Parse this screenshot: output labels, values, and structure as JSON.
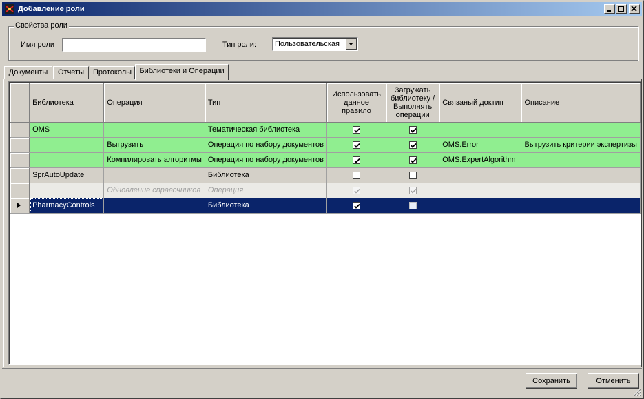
{
  "window": {
    "title": "Добавление роли"
  },
  "props": {
    "legend": "Свойства роли",
    "role_name_label": "Имя роли",
    "role_name_value": "",
    "role_type_label": "Тип роли:",
    "role_type_value": "Пользовательская"
  },
  "tabs": [
    {
      "label": "Документы"
    },
    {
      "label": "Отчеты"
    },
    {
      "label": "Протоколы"
    },
    {
      "label": "Библиотеки и Операции"
    }
  ],
  "grid": {
    "columns": [
      "Библиотека",
      "Операция",
      "Тип",
      "Использовать данное правило",
      "Загружать библиотеку / Выполнять операции",
      "Связаный доктип",
      "Описание"
    ],
    "rows": [
      {
        "library": "OMS",
        "operation": "",
        "type": "Тематическая библиотека",
        "use": true,
        "load": true,
        "doctype": "",
        "description": ""
      },
      {
        "library": "",
        "operation": "Выгрузить",
        "type": "Операция по набору документов",
        "use": true,
        "load": true,
        "doctype": "OMS.Error",
        "description": "Выгрузить критерии экспертизы"
      },
      {
        "library": "",
        "operation": "Компилировать алгоритмы",
        "type": "Операция по набору документов",
        "use": true,
        "load": true,
        "doctype": "OMS.ExpertAlgorithm",
        "description": ""
      },
      {
        "library": "SprAutoUpdate",
        "operation": "",
        "type": "Библиотека",
        "use": false,
        "load": false,
        "doctype": "",
        "description": ""
      },
      {
        "library": "",
        "operation": "Обновление справочников",
        "type": "Операция",
        "use": true,
        "load": true,
        "doctype": "",
        "description": ""
      },
      {
        "library": "PharmacyControls",
        "operation": "",
        "type": "Библиотека",
        "use": true,
        "load": false,
        "doctype": "",
        "description": ""
      }
    ]
  },
  "buttons": {
    "save": "Сохранить",
    "cancel": "Отменить"
  }
}
